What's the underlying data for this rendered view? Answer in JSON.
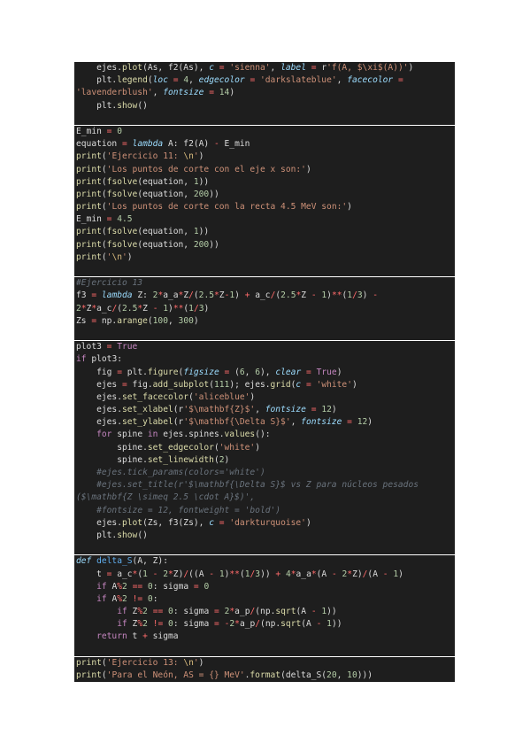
{
  "code_lines": [
    "    ejes.plot(As, f2(As), c = 'sienna', label = r'f(A, $\\xi$(A))')",
    "    plt.legend(loc = 4, edgecolor = 'darkslateblue', facecolor =",
    "'lavenderblush', fontsize = 14)",
    "    plt.show()",
    "",
    "E_min = 0",
    "equation = lambda A: f2(A) - E_min",
    "print('Ejercicio 11: \\n')",
    "print('Los puntos de corte con el eje x son:')",
    "print(fsolve(equation, 1))",
    "print(fsolve(equation, 200))",
    "print('Los puntos de corte con la recta 4.5 MeV son:')",
    "E_min = 4.5",
    "print(fsolve(equation, 1))",
    "print(fsolve(equation, 200))",
    "print('\\n')",
    "",
    "#Ejercicio 13",
    "f3 = lambda Z: 2*a_a*Z/(2.5*Z-1) + a_c/(2.5*Z - 1)**(1/3) -",
    "2*Z*a_c/(2.5*Z - 1)**(1/3)",
    "Zs = np.arange(100, 300)",
    "",
    "plot3 = True",
    "if plot3:",
    "    fig = plt.figure(figsize = (6, 6), clear = True)",
    "    ejes = fig.add_subplot(111); ejes.grid(c = 'white')",
    "    ejes.set_facecolor('aliceblue')",
    "    ejes.set_xlabel(r'$\\mathbf{Z}$', fontsize = 12)",
    "    ejes.set_ylabel(r'$\\mathbf{\\Delta S}$', fontsize = 12)",
    "    for spine in ejes.spines.values():",
    "        spine.set_edgecolor('white')",
    "        spine.set_linewidth(2)",
    "    #ejes.tick_params(colors='white')",
    "    #ejes.set_title(r'$\\mathbf{\\Delta S}$ vs Z para núcleos pesados",
    "($\\mathbf{Z \\simeq 2.5 \\cdot A}$)',",
    "    #fontsize = 12, fontweight = 'bold')",
    "    ejes.plot(Zs, f3(Zs), c = 'darkturquoise')",
    "    plt.show()",
    "",
    "def delta_S(A, Z):",
    "    t = a_c*(1 - 2*Z)/((A - 1)**(1/3)) + 4*a_a*(A - 2*Z)/(A - 1)",
    "    if A%2 == 0: sigma = 0",
    "    if A%2 != 0:",
    "        if Z%2 == 0: sigma = 2*a_p/(np.sqrt(A - 1))",
    "        if Z%2 != 0: sigma = -2*a_p/(np.sqrt(A - 1))",
    "    return t + sigma",
    "",
    "print('Ejercicio 13: \\n')",
    "print('Para el Neón, AS = {} MeV'.format(delta_S(20, 10)))"
  ]
}
